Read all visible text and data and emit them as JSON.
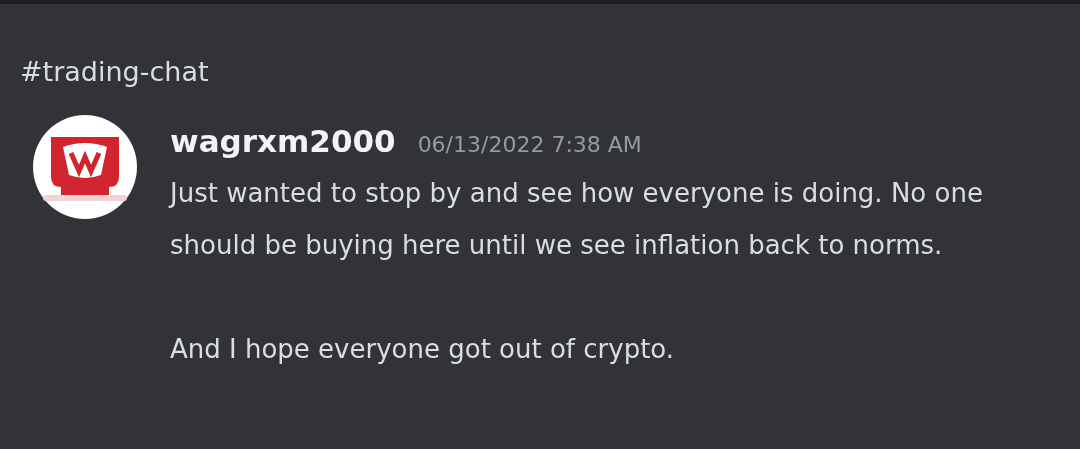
{
  "channel": {
    "name": "#trading-chat"
  },
  "message": {
    "author": "wagrxm2000",
    "timestamp": "06/13/2022 7:38 AM",
    "paragraphs": [
      "Just wanted to stop by and see how everyone is doing. No one should be buying here until we see inflation back to norms.",
      "And I hope everyone got out of crypto."
    ]
  }
}
